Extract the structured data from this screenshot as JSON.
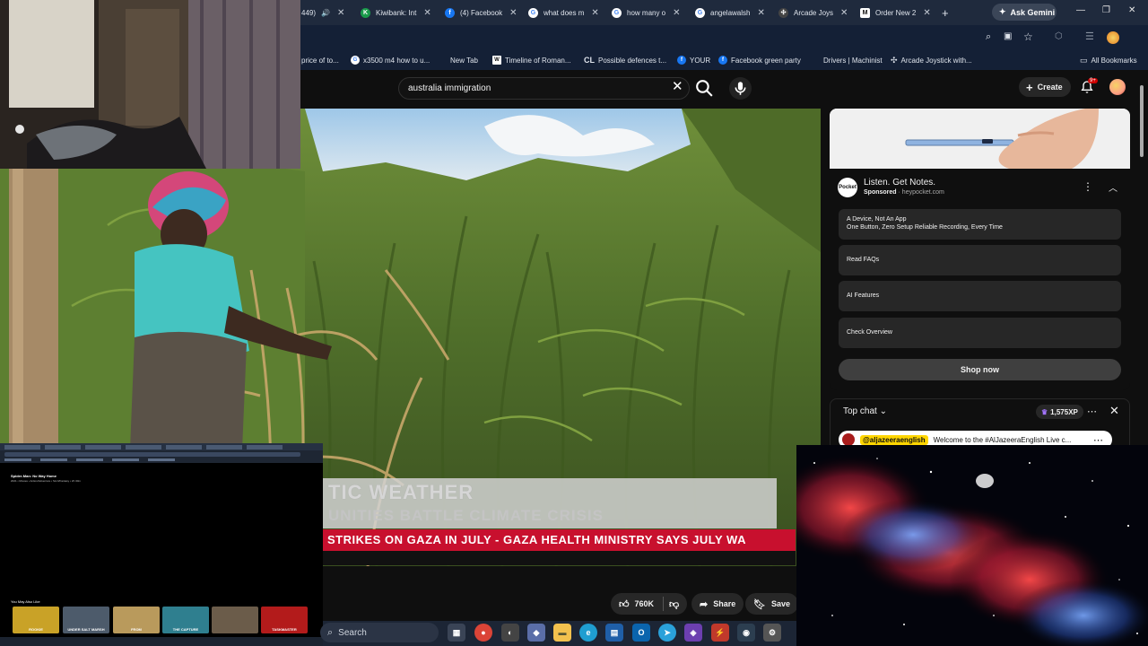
{
  "browser": {
    "tabs": [
      {
        "label": "449)",
        "favicon": "audio-icon",
        "color": "#1f2a3d"
      },
      {
        "label": "Kiwibank: Int",
        "favicon": "kiwibank-icon",
        "color": "#1a9b4b"
      },
      {
        "label": "(4) Facebook",
        "favicon": "facebook-icon",
        "color": "#1877f2"
      },
      {
        "label": "what does m",
        "favicon": "google-icon",
        "color": "#ffffff"
      },
      {
        "label": "how many o",
        "favicon": "google-icon",
        "color": "#ffffff"
      },
      {
        "label": "angelawalsh",
        "favicon": "google-icon",
        "color": "#ffffff"
      },
      {
        "label": "Arcade Joys",
        "favicon": "arcade-icon",
        "color": "#444444"
      },
      {
        "label": "Order New 2",
        "favicon": "order-icon",
        "color": "#ffffff"
      }
    ],
    "ask_gemini": "Ask Gemini",
    "bookmarks": [
      {
        "label": "price of to...",
        "favicon": ""
      },
      {
        "label": "x3500 m4 how to u...",
        "favicon": "google-icon"
      },
      {
        "label": "New Tab",
        "favicon": ""
      },
      {
        "label": "Timeline of Roman...",
        "favicon": "wikipedia-icon"
      },
      {
        "label": "Possible defences t...",
        "favicon": "cl-icon"
      },
      {
        "label": "YOUR",
        "favicon": "facebook-icon"
      },
      {
        "label": "Facebook green party",
        "favicon": "facebook-icon"
      },
      {
        "label": "Drivers | Machinist",
        "favicon": ""
      },
      {
        "label": "Arcade Joystick with...",
        "favicon": "arcade-icon"
      }
    ],
    "all_bookmarks": "All Bookmarks"
  },
  "youtube": {
    "search_query": "australia immigration",
    "create_label": "Create",
    "notification_badge": "9+",
    "video": {
      "lower_third_line1": "TIC WEATHER",
      "lower_third_line2": "UNITIES BATTLE CLIMATE CRISIS",
      "ticker": "STRIKES ON GAZA IN JULY   -   GAZA HEALTH MINISTRY SAYS JULY WA"
    },
    "actions": {
      "likes": "760K",
      "share": "Share",
      "save": "Save"
    },
    "ad": {
      "logo_text": "Pocket",
      "title": "Listen. Get Notes.",
      "sponsored": "Sponsored",
      "domain": "heypocket.com",
      "items": [
        {
          "title": "A Device, Not An App",
          "subtitle": "One Button, Zero Setup Reliable Recording, Every Time"
        },
        {
          "title": "Read FAQs",
          "subtitle": ""
        },
        {
          "title": "AI Features",
          "subtitle": ""
        },
        {
          "title": "Check Overview",
          "subtitle": ""
        }
      ],
      "cta": "Shop now"
    },
    "chat": {
      "title": "Top chat",
      "xp": "1,575XP",
      "message_user": "@aljazeeraenglish",
      "message_text": "Welcome to the #AlJazeeraEnglish Live c..."
    }
  },
  "second_screen": {
    "title": "Spider-Man: No Way Home",
    "meta": "2021 • Movies • Action/Adventure • Sci-fi/Fantasy • 2h 30m",
    "you_may_also_like": "You May Also Like",
    "thumbnails": [
      {
        "label": "ROOKIE",
        "color": "#c9a227"
      },
      {
        "label": "UNDER SALT MARSH",
        "color": "#4d5b6b"
      },
      {
        "label": "FROM",
        "color": "#b99a5c"
      },
      {
        "label": "THE CAPTURE",
        "color": "#2f7f8f"
      },
      {
        "label": "",
        "color": "#6b5c4a"
      },
      {
        "label": "TASKMASTER",
        "color": "#b31b1b"
      }
    ]
  },
  "taskbar": {
    "search_placeholder": "Search",
    "icons": [
      {
        "name": "task-view-icon",
        "color": "#3a4456"
      },
      {
        "name": "chrome-icon",
        "color": "#db4437"
      },
      {
        "name": "app-icon",
        "color": "#444444"
      },
      {
        "name": "app-icon",
        "color": "#5a6ea8"
      },
      {
        "name": "file-explorer-icon",
        "color": "#f2c14e"
      },
      {
        "name": "edge-icon",
        "color": "#1f9ed1"
      },
      {
        "name": "calculator-icon",
        "color": "#1f5fa8"
      },
      {
        "name": "outlook-icon",
        "color": "#0a64ad"
      },
      {
        "name": "telegram-icon",
        "color": "#2aa1da"
      },
      {
        "name": "app-icon",
        "color": "#6c3fb0"
      },
      {
        "name": "app-icon",
        "color": "#c0392b"
      },
      {
        "name": "app-icon",
        "color": "#2c3e50"
      },
      {
        "name": "settings-icon",
        "color": "#555555"
      }
    ]
  }
}
